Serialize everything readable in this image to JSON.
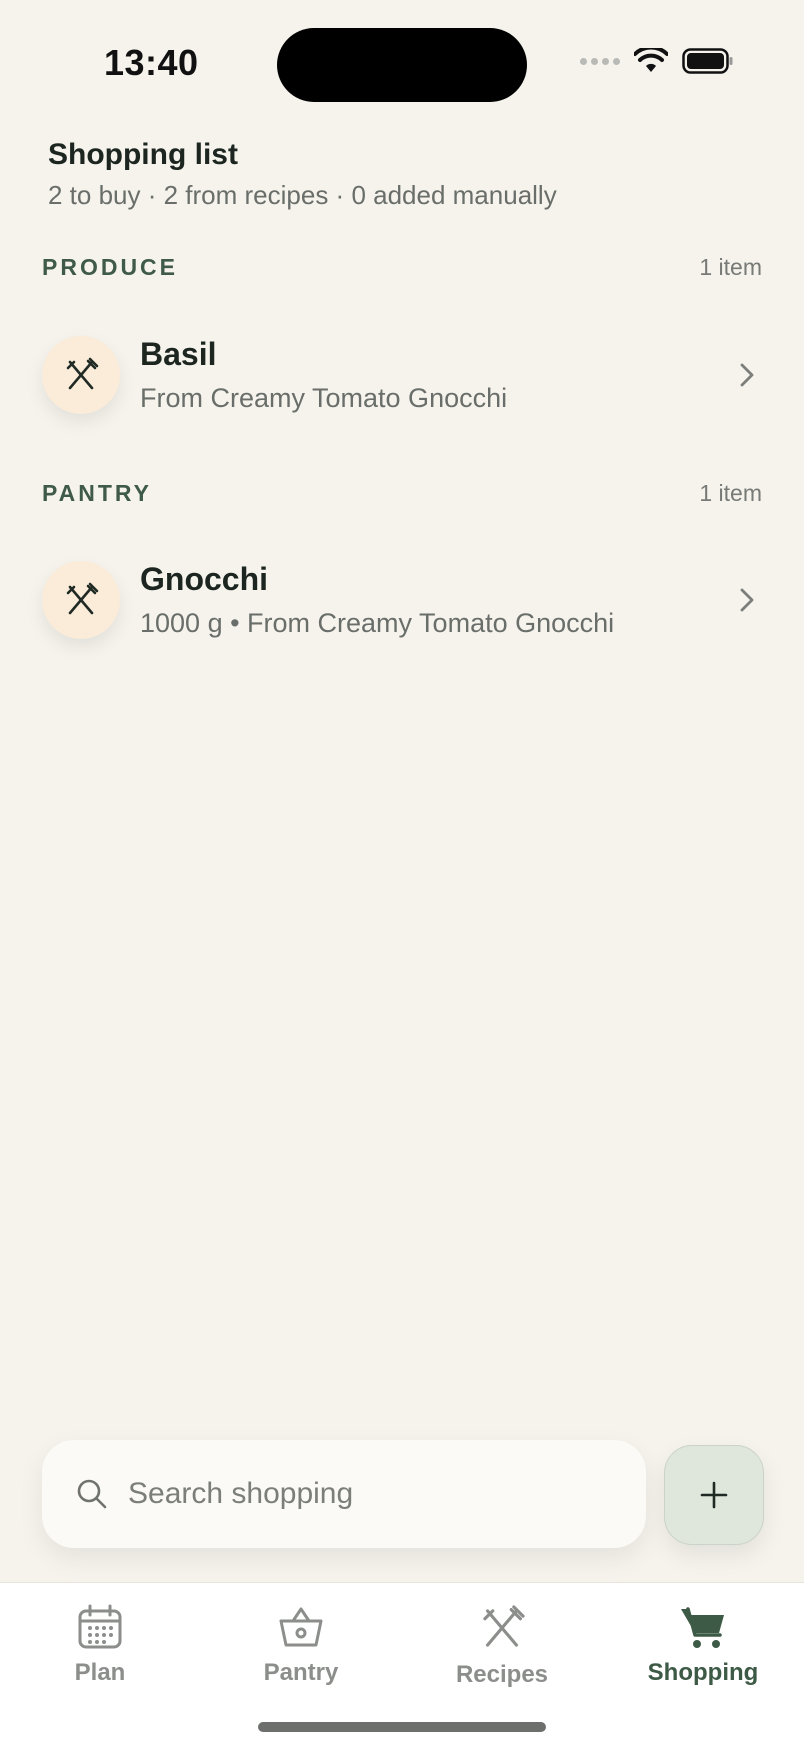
{
  "status": {
    "time": "13:40"
  },
  "header": {
    "title": "Shopping list",
    "subtitle": "2 to buy · 2 from recipes · 0 added manually"
  },
  "sections": [
    {
      "label": "PRODUCE",
      "count": "1 item",
      "items": [
        {
          "name": "Basil",
          "detail": "From Creamy Tomato Gnocchi",
          "icon": "utensils-icon"
        }
      ]
    },
    {
      "label": "PANTRY",
      "count": "1 item",
      "items": [
        {
          "name": "Gnocchi",
          "detail": "1000 g • From Creamy Tomato Gnocchi",
          "icon": "utensils-icon"
        }
      ]
    }
  ],
  "search": {
    "placeholder": "Search shopping",
    "value": ""
  },
  "add_button": {
    "icon": "plus-icon"
  },
  "tabs": [
    {
      "label": "Plan",
      "icon": "calendar-icon",
      "active": false
    },
    {
      "label": "Pantry",
      "icon": "basket-icon",
      "active": false
    },
    {
      "label": "Recipes",
      "icon": "utensils-icon",
      "active": false
    },
    {
      "label": "Shopping",
      "icon": "cart-icon",
      "active": true
    }
  ],
  "colors": {
    "background": "#f5f3ec",
    "accent": "#3d5a46",
    "item_icon_bg": "#fbebd9",
    "add_button_bg": "#dfe6dc"
  }
}
